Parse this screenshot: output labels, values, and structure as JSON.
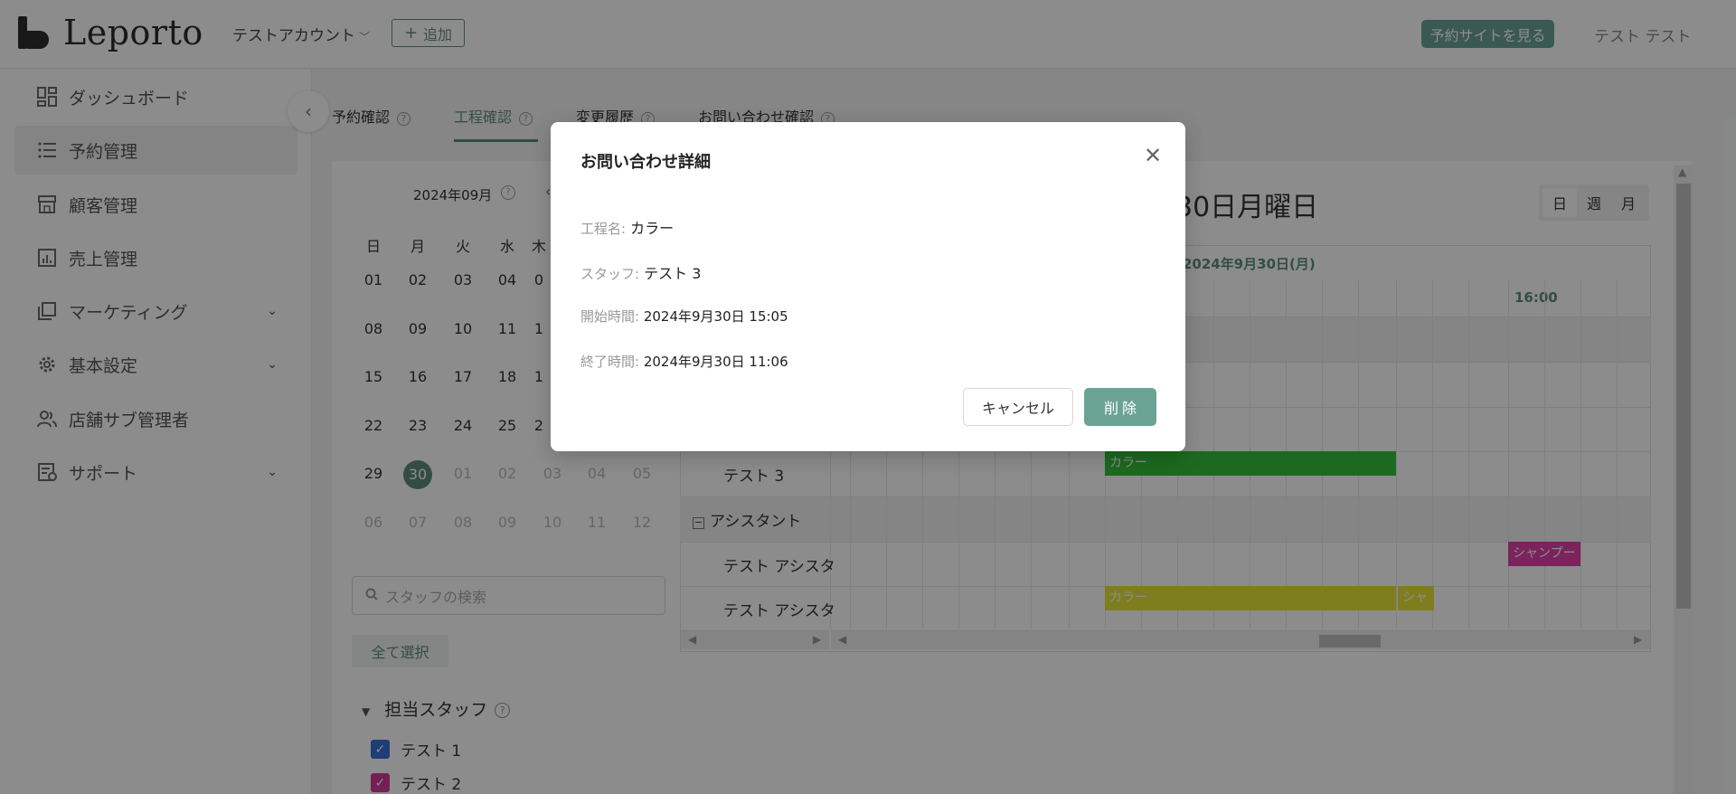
{
  "header": {
    "logo_text": "Leporto",
    "account_name": "テストアカウント",
    "add_label": "追加",
    "site_button": "予約サイトを見る",
    "user_name": "テスト テスト"
  },
  "sidebar": {
    "items": [
      {
        "label": "ダッシュボード",
        "icon": "dashboard-icon"
      },
      {
        "label": "予約管理",
        "icon": "list-icon"
      },
      {
        "label": "顧客管理",
        "icon": "store-icon"
      },
      {
        "label": "売上管理",
        "icon": "chart-icon"
      },
      {
        "label": "マーケティング",
        "icon": "copy-icon"
      },
      {
        "label": "基本設定",
        "icon": "gear-icon"
      },
      {
        "label": "店舗サブ管理者",
        "icon": "users-icon"
      },
      {
        "label": "サポート",
        "icon": "support-icon"
      }
    ]
  },
  "tabs": [
    {
      "label": "予約確認"
    },
    {
      "label": "工程確認"
    },
    {
      "label": "変更履歴"
    },
    {
      "label": "お問い合わせ確認"
    }
  ],
  "calendar": {
    "month": "2024年09月",
    "weekdays": [
      "日",
      "月",
      "火",
      "水",
      "木"
    ],
    "rows": [
      [
        "01",
        "02",
        "03",
        "04",
        "0"
      ],
      [
        "08",
        "09",
        "10",
        "11",
        "1"
      ],
      [
        "15",
        "16",
        "17",
        "18",
        "1"
      ],
      [
        "22",
        "23",
        "24",
        "25",
        "2"
      ],
      [
        "29",
        "30",
        "01",
        "02",
        "03",
        "04",
        "05"
      ],
      [
        "06",
        "07",
        "08",
        "09",
        "10",
        "11",
        "12"
      ]
    ]
  },
  "staff_filter": {
    "search_placeholder": "スタッフの検索",
    "select_all": "全て選択",
    "section_title": "担当スタッフ",
    "staff": [
      {
        "name": "テスト 1",
        "color": "#3a6fd8"
      },
      {
        "name": "テスト 2",
        "color": "#d63a9a"
      }
    ]
  },
  "schedule": {
    "day_title": "30日月曜日",
    "views": [
      "日",
      "週",
      "月"
    ],
    "date_header": "2024年9月30日(月)",
    "time_header": "16:00",
    "rows": [
      {
        "label": "テスト 3"
      },
      {
        "label": "アシスタント"
      },
      {
        "label": "テスト アシスタ"
      },
      {
        "label": "テスト アシスタ"
      }
    ],
    "events": [
      {
        "label": "カラー",
        "color": "#34c23a"
      },
      {
        "label": "シャンプー",
        "color": "#e040a8"
      },
      {
        "label": "カラー",
        "color": "#e6e63a"
      },
      {
        "label": "シャ",
        "color": "#e6e63a"
      }
    ]
  },
  "modal": {
    "title": "お問い合わせ詳細",
    "fields": [
      {
        "label": "工程名:",
        "value": "カラー"
      },
      {
        "label": "スタッフ:",
        "value": "テスト 3"
      },
      {
        "label": "開始時間:",
        "value": "2024年9月30日 15:05"
      },
      {
        "label": "終了時間:",
        "value": "2024年9月30日 11:06"
      }
    ],
    "cancel_label": "キャンセル",
    "delete_label": "削除"
  }
}
